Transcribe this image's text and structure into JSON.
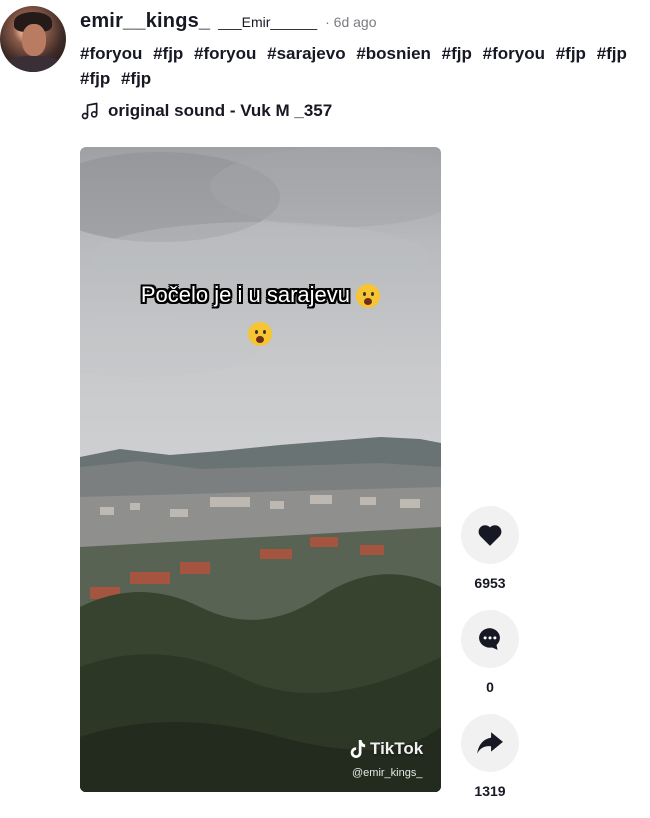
{
  "post": {
    "username": "emir__kings_",
    "nickname": "___Emir______",
    "time": "· 6d ago",
    "hashtags": [
      "#foryou",
      "#fjp",
      "#foryou",
      "#sarajevo",
      "#bosnien",
      "#fjp",
      "#foryou",
      "#fjp",
      "#fjp",
      "#fjp",
      "#fjp"
    ],
    "music": "original sound - Vuk M _357"
  },
  "video": {
    "overlay_text": "Počelo je i u sarajevu",
    "watermark_brand": "TikTok",
    "watermark_handle": "@emir_kings_"
  },
  "actions": {
    "likes": "6953",
    "comments": "0",
    "shares": "1319"
  },
  "icons": {
    "like": "heart-icon",
    "comment": "comment-icon",
    "share": "share-icon",
    "music": "music-note-icon"
  },
  "colors": {
    "text": "#161823",
    "muted": "#7a7b80",
    "action_bg": "#f1f1f2"
  }
}
